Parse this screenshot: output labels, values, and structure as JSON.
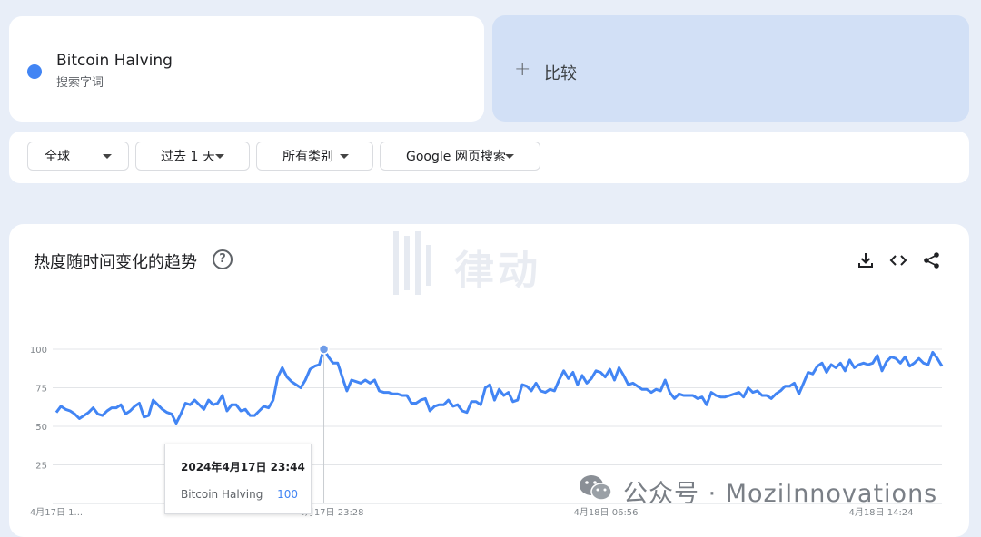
{
  "search_term": {
    "name": "Bitcoin Halving",
    "subtitle": "搜索字词",
    "color": "#4285f4"
  },
  "compare": {
    "icon": "plus-icon",
    "label": "比较"
  },
  "filters": [
    {
      "label": "全球"
    },
    {
      "label": "过去 1 天"
    },
    {
      "label": "所有类别"
    },
    {
      "label": "Google 网页搜索"
    }
  ],
  "chart_panel": {
    "title": "热度随时间变化的趋势",
    "help_icon": "question-mark-icon",
    "help_glyph": "?",
    "tools": [
      "download-icon",
      "embed-code-icon",
      "share-icon"
    ]
  },
  "tooltip": {
    "time": "2024年4月17日 23:44",
    "series": "Bitcoin Halving",
    "value": "100"
  },
  "watermark": {
    "brand_text": "律动",
    "source_text": "公众号 · MoziInnovations"
  },
  "chart_data": {
    "type": "line",
    "title": "热度随时间变化的趋势",
    "xlabel": "",
    "ylabel": "",
    "ylim": [
      0,
      100
    ],
    "yticks": [
      25,
      50,
      75,
      100
    ],
    "xtick_labels": [
      "4月17日 1...",
      "4月17日 23:28",
      "4月18日 06:56",
      "4月18日 14:24"
    ],
    "grid": true,
    "series": [
      {
        "name": "Bitcoin Halving",
        "color": "#4285f4",
        "values": [
          59,
          63,
          61,
          60,
          58,
          55,
          57,
          59,
          62,
          58,
          57,
          60,
          62,
          62,
          64,
          58,
          60,
          63,
          65,
          56,
          57,
          67,
          64,
          61,
          59,
          58,
          52,
          58,
          65,
          64,
          67,
          64,
          61,
          67,
          64,
          65,
          70,
          60,
          64,
          64,
          60,
          61,
          57,
          57,
          60,
          63,
          62,
          67,
          82,
          88,
          82,
          79,
          77,
          75,
          80,
          87,
          89,
          90,
          100,
          95,
          91,
          91,
          82,
          73,
          80,
          79,
          78,
          80,
          78,
          80,
          73,
          72,
          72,
          71,
          71,
          70,
          70,
          65,
          65,
          67,
          68,
          60,
          63,
          64,
          64,
          67,
          63,
          64,
          60,
          59,
          66,
          66,
          64,
          75,
          77,
          67,
          74,
          70,
          72,
          66,
          67,
          77,
          76,
          73,
          78,
          73,
          72,
          74,
          73,
          80,
          86,
          81,
          85,
          77,
          83,
          78,
          81,
          86,
          85,
          82,
          87,
          80,
          88,
          83,
          77,
          78,
          76,
          74,
          74,
          72,
          74,
          73,
          80,
          72,
          68,
          71,
          70,
          70,
          70,
          68,
          69,
          64,
          72,
          70,
          69,
          69,
          70,
          71,
          72,
          69,
          75,
          72,
          73,
          70,
          70,
          68,
          71,
          73,
          76,
          76,
          78,
          71,
          78,
          85,
          84,
          89,
          91,
          85,
          90,
          88,
          91,
          86,
          93,
          88,
          90,
          91,
          90,
          91,
          96,
          86,
          92,
          95,
          94,
          91,
          95,
          89,
          91,
          94,
          91,
          90,
          98,
          94,
          89
        ]
      }
    ],
    "highlight": {
      "series": "Bitcoin Halving",
      "index": 58,
      "value": 100
    }
  }
}
